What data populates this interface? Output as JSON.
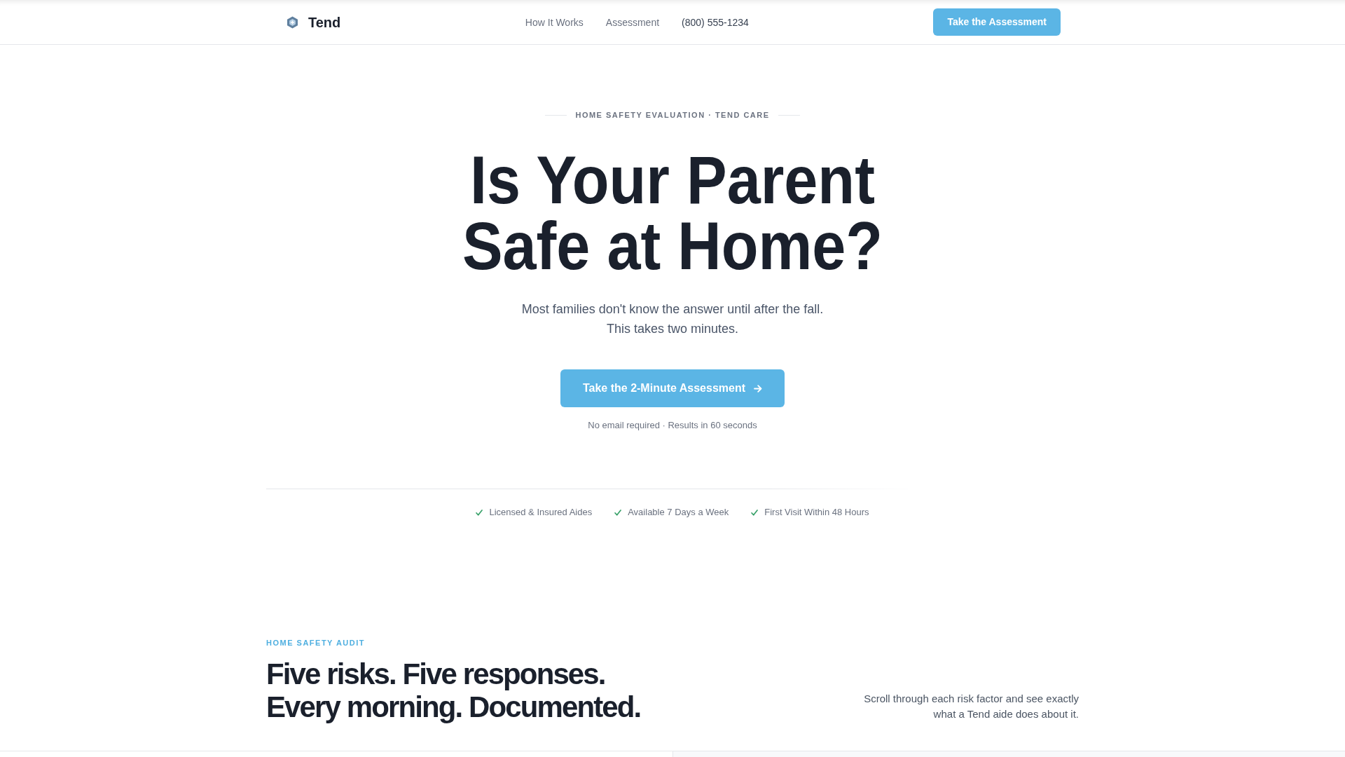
{
  "header": {
    "brand": "Tend",
    "nav_links": [
      "How It Works",
      "Assessment"
    ],
    "phone": "(800) 555-1234",
    "cta": "Take the Assessment"
  },
  "hero": {
    "eyebrow": "HOME SAFETY EVALUATION · TEND CARE",
    "headline": "Is Your Parent Safe at Home?",
    "subtitle": "Most families don't know the answer until after the fall. This takes two minutes.",
    "cta": "Take the 2-Minute Assessment",
    "note": "No email required · Results in 60 seconds",
    "trust_points": [
      "Licensed & Insured Aides",
      "Available 7 Days a Week",
      "First Visit Within 48 Hours"
    ]
  },
  "audit_section": {
    "eyebrow": "HOME SAFETY AUDIT",
    "headline": "Five risks. Five responses. Every morning. Documented.",
    "description": "Scroll through each risk factor and see exactly what a Tend aide does about it."
  }
}
